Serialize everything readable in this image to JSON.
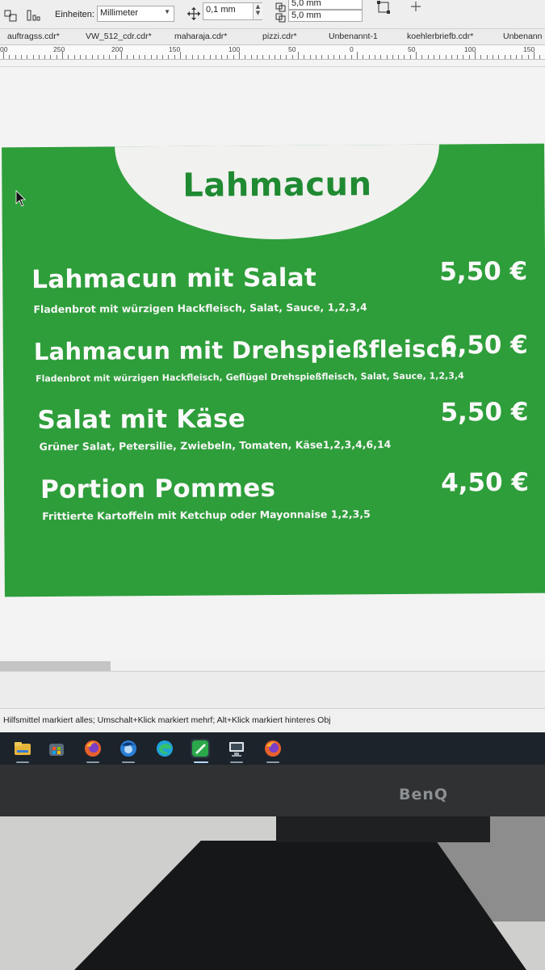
{
  "toolbar": {
    "units_label": "Einheiten:",
    "units_value": "Millimeter",
    "nudge_value": "0,1 mm",
    "dup_x_value": "5,0 mm",
    "dup_y_value": "5,0 mm"
  },
  "tabs": [
    {
      "label": "auftragss.cdr*"
    },
    {
      "label": "VW_512_cdr.cdr*"
    },
    {
      "label": "maharaja.cdr*"
    },
    {
      "label": "pizzi.cdr*"
    },
    {
      "label": "Unbenannt-1"
    },
    {
      "label": "koehlerbriefb.cdr*"
    },
    {
      "label": "Unbenann"
    }
  ],
  "ruler": {
    "labels": [
      "00",
      "250",
      "200",
      "150",
      "100",
      "50",
      "0",
      "50",
      "100",
      "150"
    ]
  },
  "menu": {
    "title": "Lahmacun",
    "items": [
      {
        "name": "Lahmacun mit Salat",
        "description": "Fladenbrot mit würzigen Hackfleisch, Salat, Sauce, 1,2,3,4",
        "price": "5,50 €"
      },
      {
        "name": "Lahmacun mit Drehspießfleisch",
        "description": "Fladenbrot mit würzigen Hackfleisch, Geflügel Drehspießfleisch, Salat, Sauce, 1,2,3,4",
        "price": "6,50 €"
      },
      {
        "name": "Salat mit Käse",
        "description": "Grüner Salat, Petersilie, Zwiebeln, Tomaten, Käse1,2,3,4,6,14",
        "price": "5,50 €"
      },
      {
        "name": "Portion Pommes",
        "description": "Frittierte Kartoffeln mit Ketchup oder Mayonnaise 1,2,3,5",
        "price": "4,50 €"
      }
    ]
  },
  "status": {
    "hint": "Hilfsmittel markiert alles; Umschalt+Klick markiert mehrf; Alt+Klick markiert hinteres Obj"
  },
  "taskbar": {
    "apps": [
      {
        "icon": "file-explorer-icon",
        "color": "#e8b53a"
      },
      {
        "icon": "store-icon",
        "color": "#5a6b7c"
      },
      {
        "icon": "firefox-icon",
        "color": "#e8612c"
      },
      {
        "icon": "thunderbird-icon",
        "color": "#2a7fd8"
      },
      {
        "icon": "edge-icon",
        "color": "#1fa4d8"
      },
      {
        "icon": "coreldraw-icon",
        "color": "#2aa84a"
      },
      {
        "icon": "remote-desktop-icon",
        "color": "#9aa5b0"
      },
      {
        "icon": "firefox-icon",
        "color": "#e8612c"
      }
    ]
  },
  "monitor": {
    "brand": "BenQ"
  },
  "colors": {
    "menu_green": "#2e9e3a",
    "title_green": "#1f8a32",
    "oval": "#f1f1ef"
  }
}
